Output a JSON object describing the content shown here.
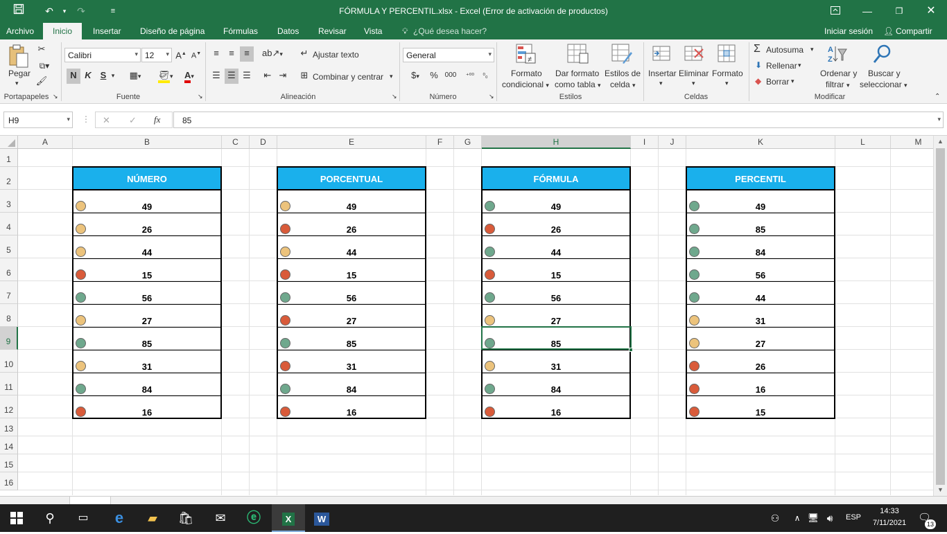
{
  "window": {
    "title": "FÓRMULA Y PERCENTIL.xlsx - Excel (Error de activación de productos)"
  },
  "ribbon_tabs": [
    "Archivo",
    "Inicio",
    "Insertar",
    "Diseño de página",
    "Fórmulas",
    "Datos",
    "Revisar",
    "Vista"
  ],
  "tell_me": "¿Qué desea hacer?",
  "account": {
    "sign_in": "Iniciar sesión",
    "share": "Compartir"
  },
  "clipboard": {
    "paste": "Pegar",
    "group": "Portapapeles"
  },
  "font": {
    "name": "Calibri",
    "size": "12",
    "bold": "N",
    "italic": "K",
    "underline": "S",
    "group": "Fuente"
  },
  "alignment": {
    "wrap": "Ajustar texto",
    "merge": "Combinar y centrar",
    "group": "Alineación"
  },
  "number": {
    "format": "General",
    "currency": "$",
    "percent": "%",
    "thousands": "000",
    "group": "Número"
  },
  "styles": {
    "conditional": [
      "Formato",
      "condicional"
    ],
    "table": [
      "Dar formato",
      "como tabla"
    ],
    "cell": [
      "Estilos de",
      "celda"
    ],
    "group": "Estilos"
  },
  "cells": {
    "insert": "Insertar",
    "delete": "Eliminar",
    "format": "Formato",
    "group": "Celdas"
  },
  "editing": {
    "autosum": "Autosuma",
    "fill": "Rellenar",
    "clear": "Borrar",
    "sort": [
      "Ordenar y",
      "filtrar"
    ],
    "find": [
      "Buscar y",
      "seleccionar"
    ],
    "group": "Modificar"
  },
  "formula_bar": {
    "name_box": "H9",
    "fx": "fx",
    "value": "85"
  },
  "columns": [
    "A",
    "B",
    "C",
    "D",
    "E",
    "F",
    "G",
    "H",
    "I",
    "J",
    "K",
    "L",
    "M"
  ],
  "rows": [
    "1",
    "2",
    "3",
    "4",
    "5",
    "6",
    "7",
    "8",
    "9",
    "10",
    "11",
    "12",
    "13",
    "14",
    "15",
    "16"
  ],
  "colors": {
    "green": "#6fa88d",
    "yellow": "#ecc37c",
    "red": "#d95b3a",
    "header_blue": "#1ab0ec",
    "excel_green": "#217346"
  },
  "tables": [
    {
      "header": "NÚMERO",
      "values": [
        "49",
        "26",
        "44",
        "15",
        "56",
        "27",
        "85",
        "31",
        "84",
        "16"
      ],
      "icons": [
        "yellow",
        "yellow",
        "yellow",
        "red",
        "green",
        "yellow",
        "green",
        "yellow",
        "green",
        "red"
      ]
    },
    {
      "header": "PORCENTUAL",
      "values": [
        "49",
        "26",
        "44",
        "15",
        "56",
        "27",
        "85",
        "31",
        "84",
        "16"
      ],
      "icons": [
        "yellow",
        "red",
        "yellow",
        "red",
        "green",
        "red",
        "green",
        "red",
        "green",
        "red"
      ]
    },
    {
      "header": "FÓRMULA",
      "values": [
        "49",
        "26",
        "44",
        "15",
        "56",
        "27",
        "85",
        "31",
        "84",
        "16"
      ],
      "icons": [
        "green",
        "red",
        "green",
        "red",
        "green",
        "yellow",
        "green",
        "yellow",
        "green",
        "red"
      ]
    },
    {
      "header": "PERCENTIL",
      "values": [
        "49",
        "85",
        "84",
        "56",
        "44",
        "31",
        "27",
        "26",
        "16",
        "15"
      ],
      "icons": [
        "green",
        "green",
        "green",
        "green",
        "green",
        "yellow",
        "yellow",
        "red",
        "red",
        "red"
      ]
    }
  ],
  "taskbar": {
    "lang": "ESP",
    "time": "14:33",
    "date": "7/11/2021",
    "notifications": "13"
  }
}
